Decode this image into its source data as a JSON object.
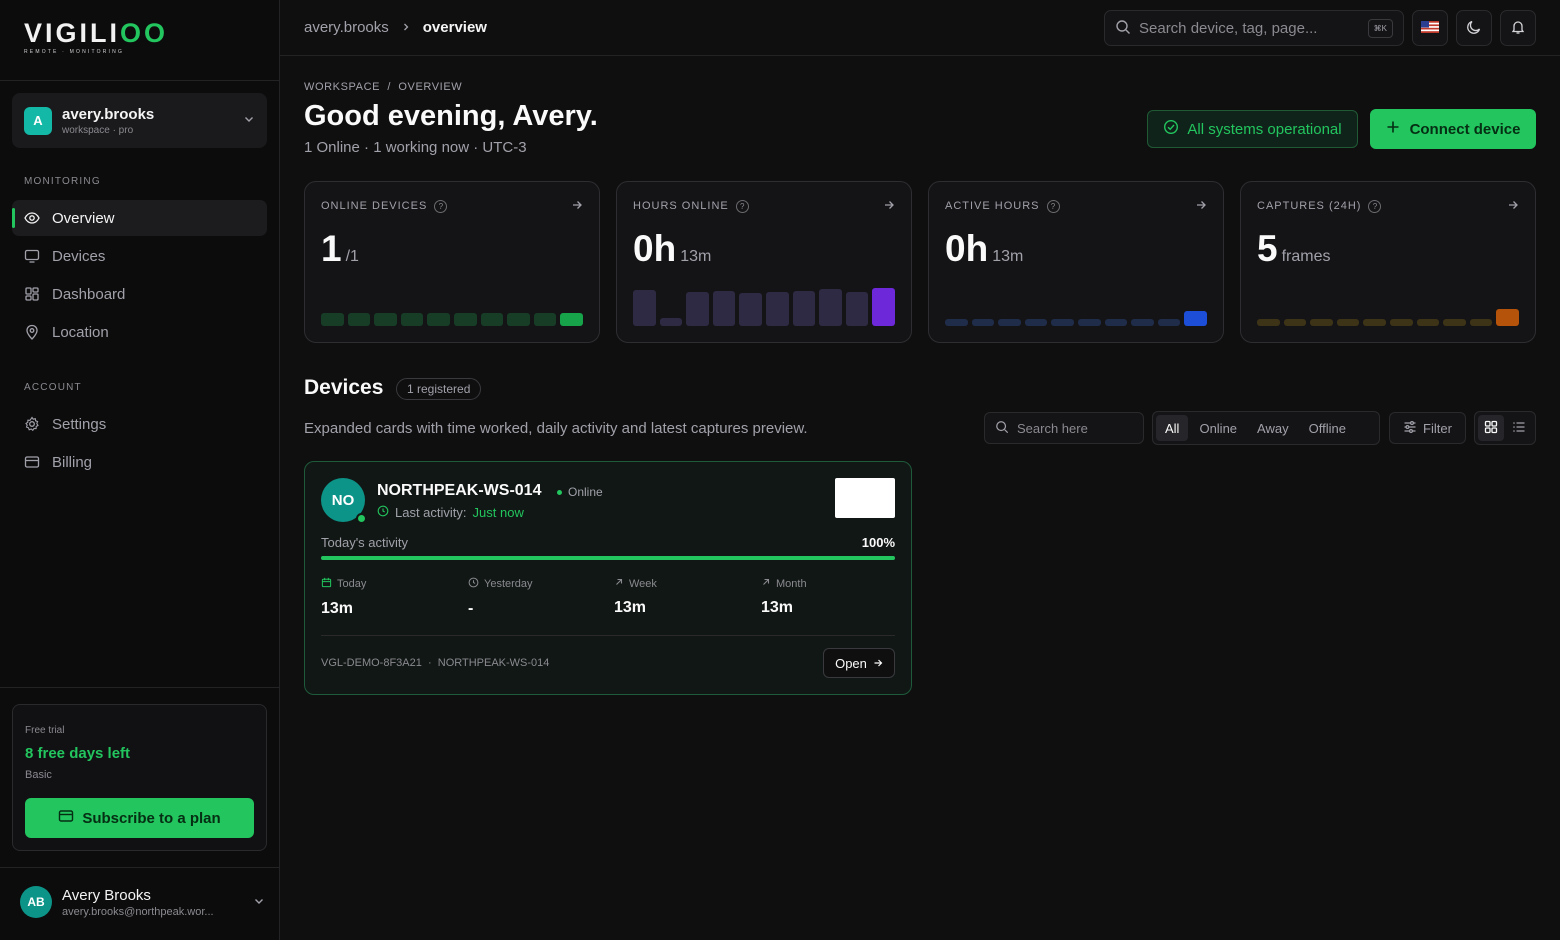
{
  "brand": {
    "name_main": "VIGILI",
    "name_accent": "OO",
    "tagline": "REMOTE · MONITORING"
  },
  "workspace": {
    "initial": "A",
    "name": "avery.brooks",
    "sub": "workspace · pro"
  },
  "sidebar": {
    "monitoring_label": "MONITORING",
    "monitoring_items": [
      {
        "label": "Overview",
        "icon": "eye-icon",
        "active": true
      },
      {
        "label": "Devices",
        "icon": "monitor-icon",
        "active": false
      },
      {
        "label": "Dashboard",
        "icon": "grid-icon",
        "active": false
      },
      {
        "label": "Location",
        "icon": "map-pin-icon",
        "active": false
      }
    ],
    "account_label": "ACCOUNT",
    "account_items": [
      {
        "label": "Settings",
        "icon": "gear-icon"
      },
      {
        "label": "Billing",
        "icon": "credit-card-icon"
      }
    ]
  },
  "trial": {
    "label": "Free trial",
    "days": "8 free days left",
    "plan": "Basic",
    "button": "Subscribe to a plan"
  },
  "user": {
    "initials": "AB",
    "name": "Avery Brooks",
    "email": "avery.brooks@northpeak.wor..."
  },
  "topbar": {
    "breadcrumb": [
      "avery.brooks",
      "overview"
    ],
    "search_placeholder": "Search device, tag, page...",
    "shortcut": "⌘K"
  },
  "header": {
    "crumb": "WORKSPACE  /  OVERVIEW",
    "greeting": "Good evening, Avery.",
    "subline": "1 Online · 1 working now · UTC-3",
    "status": "All systems operational",
    "connect": "Connect device"
  },
  "stats": [
    {
      "title": "ONLINE DEVICES",
      "value": "1",
      "unit": "/1",
      "color_dim": "#173d27",
      "color_hi": "#16a34a",
      "bars": [
        0.33,
        0.33,
        0.33,
        0.33,
        0.33,
        0.33,
        0.33,
        0.33,
        0.33,
        0.33
      ]
    },
    {
      "title": "HOURS ONLINE",
      "value": "0h",
      "unit": "13m",
      "color_dim": "#2e2a44",
      "color_hi": "#6d28d9",
      "bars": [
        0.9,
        0.2,
        0.85,
        0.88,
        0.82,
        0.85,
        0.88,
        0.92,
        0.85,
        0.95
      ]
    },
    {
      "title": "ACTIVE HOURS",
      "value": "0h",
      "unit": "13m",
      "color_dim": "#1f2d4a",
      "color_hi": "#1d4ed8",
      "bars": [
        0.17,
        0.17,
        0.17,
        0.17,
        0.17,
        0.17,
        0.17,
        0.17,
        0.17,
        0.38
      ]
    },
    {
      "title": "CAPTURES (24H)",
      "value": "5",
      "unit": "frames",
      "color_dim": "#3d3317",
      "color_hi": "#b45309",
      "bars": [
        0.17,
        0.17,
        0.17,
        0.17,
        0.17,
        0.17,
        0.17,
        0.17,
        0.17,
        0.42
      ]
    }
  ],
  "devices": {
    "title": "Devices",
    "badge": "1 registered",
    "description": "Expanded cards with time worked, daily activity and latest captures preview.",
    "search_placeholder": "Search here",
    "filters": [
      "All",
      "Online",
      "Away",
      "Offline"
    ],
    "filter_button": "Filter",
    "card": {
      "initials": "NO",
      "name": "NORTHPEAK-WS-014",
      "status": "Online",
      "last_label": "Last activity:",
      "last_value": "Just now",
      "activity_label": "Today's activity",
      "activity_pct": "100%",
      "activity_fraction": 1.0,
      "metrics": [
        {
          "label": "Today",
          "value": "13m",
          "icon": "calendar-icon"
        },
        {
          "label": "Yesterday",
          "value": "-",
          "icon": "clock-icon"
        },
        {
          "label": "Week",
          "value": "13m",
          "icon": "arrow-up-right-icon"
        },
        {
          "label": "Month",
          "value": "13m",
          "icon": "arrow-up-right-icon"
        }
      ],
      "footer": "VGL-DEMO-8F3A21  ·  NORTHPEAK-WS-014",
      "open": "Open"
    }
  }
}
